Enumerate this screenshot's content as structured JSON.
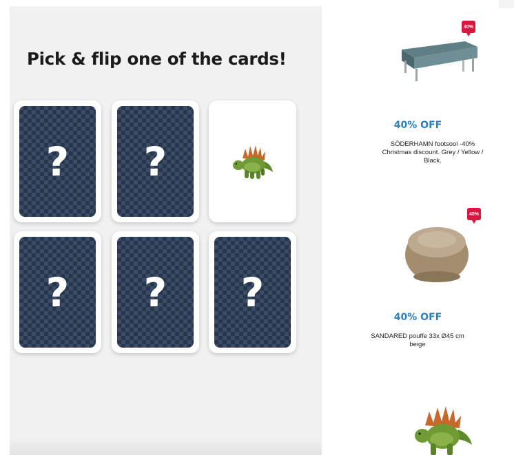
{
  "game": {
    "title": "Pick & flip one of the cards!",
    "cards": [
      {
        "state": "face-down",
        "symbol": "?"
      },
      {
        "state": "face-down",
        "symbol": "?"
      },
      {
        "state": "face-up",
        "icon": "plush-dinosaur-toy-icon"
      },
      {
        "state": "face-down",
        "symbol": "?"
      },
      {
        "state": "face-down",
        "symbol": "?"
      },
      {
        "state": "face-down",
        "symbol": "?"
      }
    ]
  },
  "offers": [
    {
      "badge": "40%",
      "label": "40% OFF",
      "description": "SÖDERHAMN footsool -40% Christmas discount. Grey / Yellow / Black.",
      "icon": "footstool-icon"
    },
    {
      "badge": "40%",
      "label": "40% OFF",
      "description": "SANDARED pouffe 33x Ø45 cm beige",
      "icon": "pouffe-icon"
    },
    {
      "icon": "plush-dinosaur-toy-icon"
    }
  ],
  "colors": {
    "panel_background": "#f1f1f2",
    "card_back": "#3a4c66",
    "offer_accent": "#2f7fb8",
    "badge": "#d6173e"
  }
}
